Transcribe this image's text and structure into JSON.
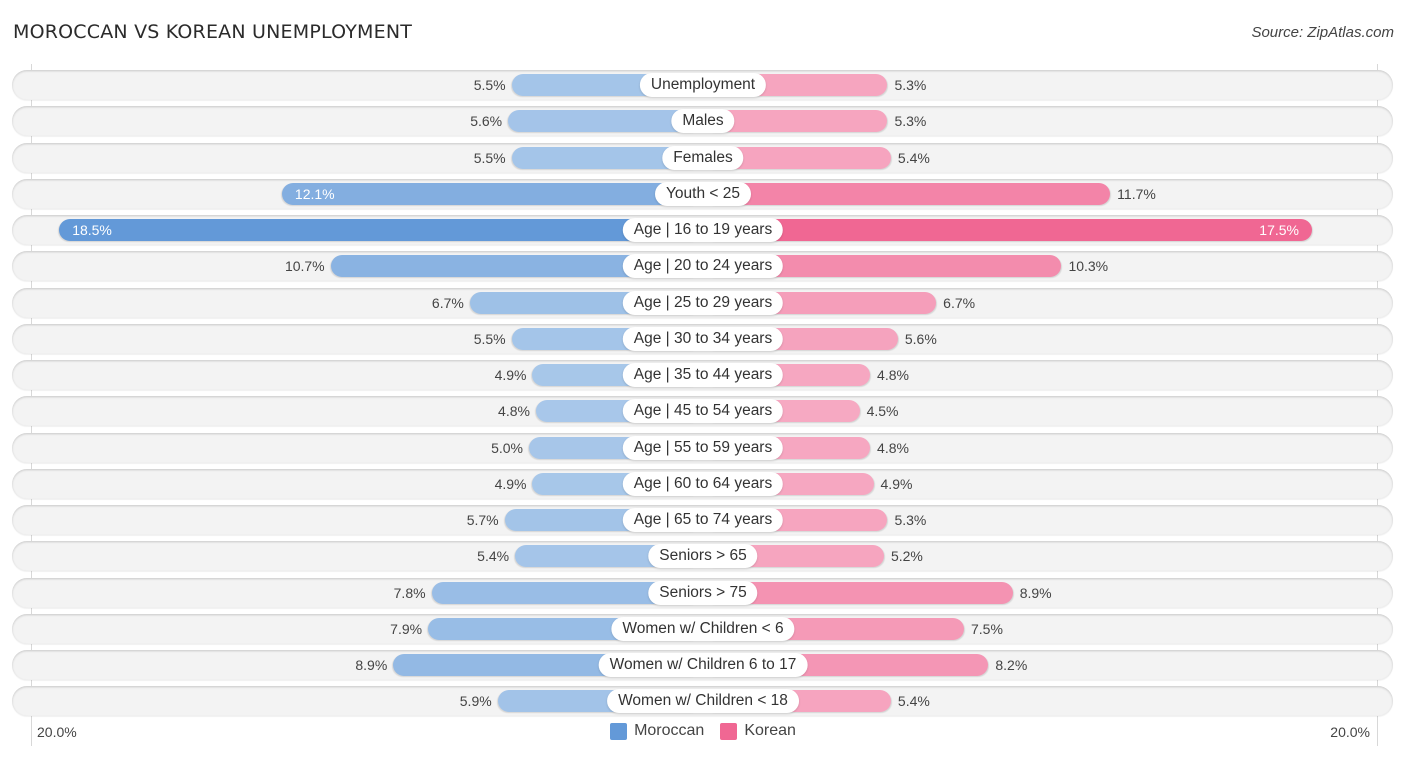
{
  "header": {
    "title": "MOROCCAN VS KOREAN UNEMPLOYMENT",
    "source": "Source: ZipAtlas.com"
  },
  "axis": {
    "left_label": "20.0%",
    "right_label": "20.0%"
  },
  "legend": {
    "items": [
      {
        "name": "Moroccan",
        "color": "#6399d8"
      },
      {
        "name": "Korean",
        "color": "#f06793"
      }
    ]
  },
  "colors": {
    "moroccan_strong": "#6399d8",
    "moroccan_light": "#a9c8ea",
    "korean_strong": "#f06793",
    "korean_light": "#f6a9c2"
  },
  "chart_data": {
    "type": "bar",
    "orientation": "horizontal-diverging",
    "title": "MOROCCAN VS KOREAN UNEMPLOYMENT",
    "source": "Source: ZipAtlas.com",
    "xlim": [
      -20,
      20
    ],
    "x_tick_labels": [
      "20.0%",
      "20.0%"
    ],
    "legend_position": "bottom-center",
    "categories": [
      "Unemployment",
      "Males",
      "Females",
      "Youth < 25",
      "Age | 16 to 19 years",
      "Age | 20 to 24 years",
      "Age | 25 to 29 years",
      "Age | 30 to 34 years",
      "Age | 35 to 44 years",
      "Age | 45 to 54 years",
      "Age | 55 to 59 years",
      "Age | 60 to 64 years",
      "Age | 65 to 74 years",
      "Seniors > 65",
      "Seniors > 75",
      "Women w/ Children < 6",
      "Women w/ Children 6 to 17",
      "Women w/ Children < 18"
    ],
    "series": [
      {
        "name": "Moroccan",
        "side": "left",
        "values": [
          5.5,
          5.6,
          5.5,
          12.1,
          18.5,
          10.7,
          6.7,
          5.5,
          4.9,
          4.8,
          5.0,
          4.9,
          5.7,
          5.4,
          7.8,
          7.9,
          8.9,
          5.9
        ],
        "labels": [
          "5.5%",
          "5.6%",
          "5.5%",
          "12.1%",
          "18.5%",
          "10.7%",
          "6.7%",
          "5.5%",
          "4.9%",
          "4.8%",
          "5.0%",
          "4.9%",
          "5.7%",
          "5.4%",
          "7.8%",
          "7.9%",
          "8.9%",
          "5.9%"
        ]
      },
      {
        "name": "Korean",
        "side": "right",
        "values": [
          5.3,
          5.3,
          5.4,
          11.7,
          17.5,
          10.3,
          6.7,
          5.6,
          4.8,
          4.5,
          4.8,
          4.9,
          5.3,
          5.2,
          8.9,
          7.5,
          8.2,
          5.4
        ],
        "labels": [
          "5.3%",
          "5.3%",
          "5.4%",
          "11.7%",
          "17.5%",
          "10.3%",
          "6.7%",
          "5.6%",
          "4.8%",
          "4.5%",
          "4.8%",
          "4.9%",
          "5.3%",
          "5.2%",
          "8.9%",
          "7.5%",
          "8.2%",
          "5.4%"
        ]
      }
    ]
  }
}
